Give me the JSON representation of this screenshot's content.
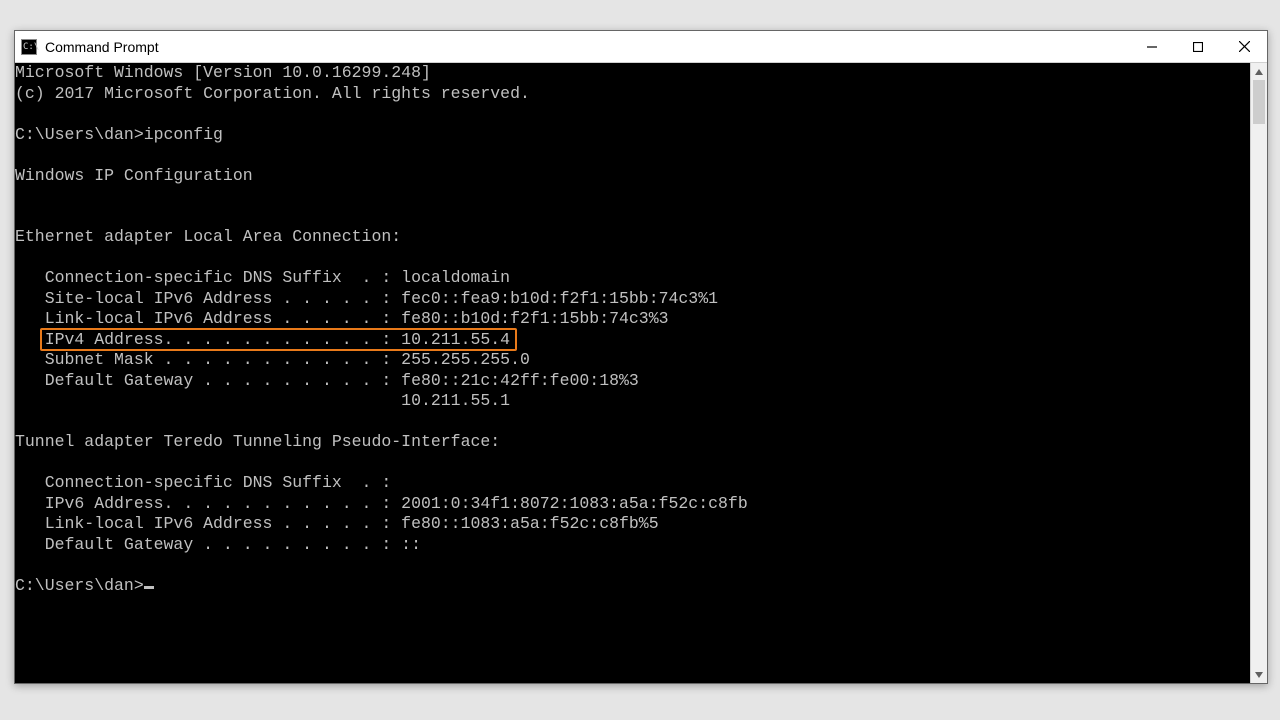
{
  "window": {
    "title": "Command Prompt",
    "app_icon_text": "C:\\"
  },
  "terminal": {
    "lines": [
      "Microsoft Windows [Version 10.0.16299.248]",
      "(c) 2017 Microsoft Corporation. All rights reserved.",
      "",
      "C:\\Users\\dan>ipconfig",
      "",
      "Windows IP Configuration",
      "",
      "",
      "Ethernet adapter Local Area Connection:",
      "",
      "   Connection-specific DNS Suffix  . : localdomain",
      "   Site-local IPv6 Address . . . . . : fec0::fea9:b10d:f2f1:15bb:74c3%1",
      "   Link-local IPv6 Address . . . . . : fe80::b10d:f2f1:15bb:74c3%3",
      "   IPv4 Address. . . . . . . . . . . : 10.211.55.4",
      "   Subnet Mask . . . . . . . . . . . : 255.255.255.0",
      "   Default Gateway . . . . . . . . . : fe80::21c:42ff:fe00:18%3",
      "                                       10.211.55.1",
      "",
      "Tunnel adapter Teredo Tunneling Pseudo-Interface:",
      "",
      "   Connection-specific DNS Suffix  . :",
      "   IPv6 Address. . . . . . . . . . . : 2001:0:34f1:8072:1083:a5a:f52c:c8fb",
      "   Link-local IPv6 Address . . . . . : fe80::1083:a5a:f52c:c8fb%5",
      "   Default Gateway . . . . . . . . . : ::",
      "",
      "C:\\Users\\dan>"
    ],
    "prompt_path": "C:\\Users\\dan>",
    "highlight_line_index": 13
  },
  "colors": {
    "highlight_border": "#e97a1a"
  }
}
